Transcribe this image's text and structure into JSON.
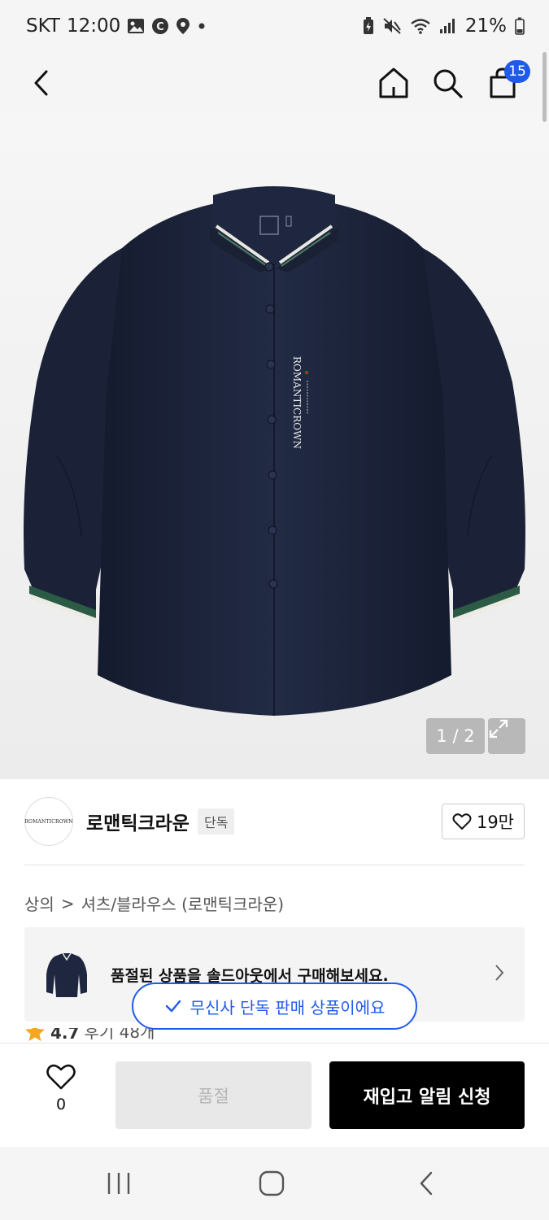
{
  "status_bar": {
    "carrier": "SKT",
    "time": "12:00",
    "battery": "21%",
    "icons_left": [
      "gallery-icon",
      "c-app-icon",
      "location-icon",
      "dot-icon"
    ],
    "icons_right": [
      "battery-saver-icon",
      "mute-icon",
      "wifi-icon",
      "signal-icon",
      "battery-icon"
    ]
  },
  "header": {
    "icons": [
      "back-icon",
      "home-icon",
      "search-icon",
      "cart-icon"
    ],
    "cart_count": "15"
  },
  "gallery": {
    "counter": "1 / 2",
    "expand_icon": "expand-icon",
    "shirt_logo_text": "ROMANTICROWN"
  },
  "brand": {
    "logo_text": "ROMANTICROWN",
    "name": "로맨틱크라운",
    "tag": "단독",
    "likes": "19만"
  },
  "breadcrumb": {
    "category": "상의",
    "separator": ">",
    "subcategory": "셔츠/블라우스 (로맨틱크라운)"
  },
  "promo": {
    "text": "품절된 상품을 솔드아웃에서 구매해보세요."
  },
  "toast": {
    "text": "무신사 단독 판매 상품이에요"
  },
  "rating": {
    "score": "4.7",
    "reviews": "후기 48개"
  },
  "bottom_bar": {
    "wish_count": "0",
    "soldout_label": "품절",
    "restock_label": "재입고 알림 신청"
  },
  "colors": {
    "accent": "#1f5bea",
    "shirt": "#1f2740",
    "primary_button": "#000000",
    "disabled_button": "#e8e8e8"
  }
}
